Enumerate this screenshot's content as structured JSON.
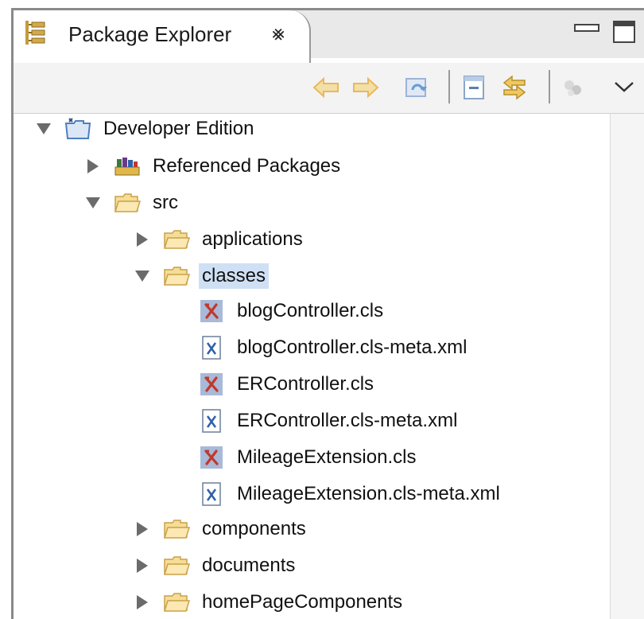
{
  "view": {
    "title": "Package Explorer",
    "close_glyph": "⨳"
  },
  "toolbar": {
    "buttons": [
      {
        "name": "back-icon"
      },
      {
        "name": "forward-icon"
      },
      {
        "name": "go-up-icon"
      },
      {
        "name": "collapse-all-icon"
      },
      {
        "name": "link-with-editor-icon"
      },
      {
        "name": "view-menu-extra-icon"
      },
      {
        "name": "view-menu-chevron-icon"
      }
    ]
  },
  "tree": [
    {
      "label": "Developer Edition",
      "depth": 0,
      "expanded": true,
      "icon": "project-icon"
    },
    {
      "label": "Referenced Packages",
      "depth": 1,
      "expanded": false,
      "icon": "referenced-packages-icon"
    },
    {
      "label": "src",
      "depth": 1,
      "expanded": true,
      "icon": "folder-icon"
    },
    {
      "label": "applications",
      "depth": 2,
      "expanded": false,
      "icon": "folder-icon"
    },
    {
      "label": "classes",
      "depth": 2,
      "expanded": true,
      "icon": "folder-icon",
      "selected": true
    },
    {
      "label": "blogController.cls",
      "depth": 3,
      "leaf": true,
      "icon": "apex-class-icon"
    },
    {
      "label": "blogController.cls-meta.xml",
      "depth": 3,
      "leaf": true,
      "icon": "xml-file-icon"
    },
    {
      "label": "ERController.cls",
      "depth": 3,
      "leaf": true,
      "icon": "apex-class-icon"
    },
    {
      "label": "ERController.cls-meta.xml",
      "depth": 3,
      "leaf": true,
      "icon": "xml-file-icon"
    },
    {
      "label": "MileageExtension.cls",
      "depth": 3,
      "leaf": true,
      "icon": "apex-class-icon"
    },
    {
      "label": "MileageExtension.cls-meta.xml",
      "depth": 3,
      "leaf": true,
      "icon": "xml-file-icon"
    },
    {
      "label": "components",
      "depth": 2,
      "expanded": false,
      "icon": "folder-icon"
    },
    {
      "label": "documents",
      "depth": 2,
      "expanded": false,
      "icon": "folder-icon"
    },
    {
      "label": "homePageComponents",
      "depth": 2,
      "expanded": false,
      "icon": "folder-icon"
    }
  ],
  "colors": {
    "selection": "#cfe0f5",
    "folder": "#e9c66a",
    "apex_x": "#c0392b",
    "xml_x": "#2f5fa8",
    "disabled_icon": "#e8b95a"
  }
}
